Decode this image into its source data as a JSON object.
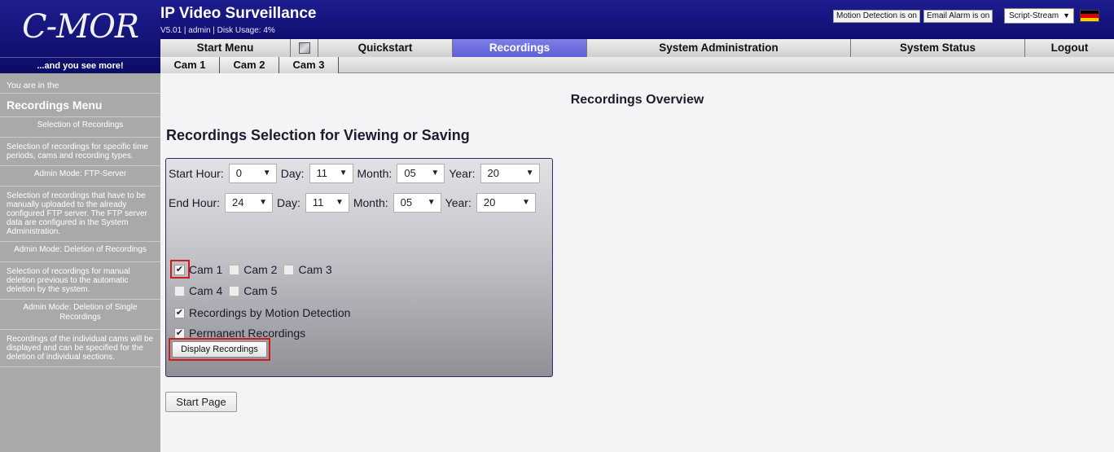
{
  "logo": {
    "text": "C-MOR",
    "tagline": "...and you see more!"
  },
  "header": {
    "title": "IP Video Surveillance",
    "version_info": "V5.01 | admin | Disk Usage: 4%",
    "motion_chip": "Motion Detection is on",
    "email_chip": "Email Alarm is on",
    "script_select": "Script-Stream",
    "flag_colors": [
      "#000000",
      "#dd0000",
      "#ffce00"
    ]
  },
  "mainnav": {
    "start": "Start Menu",
    "icon": "screen-icon",
    "quickstart": "Quickstart",
    "recordings": "Recordings",
    "sysadmin": "System Administration",
    "status": "System Status",
    "logout": "Logout",
    "active_color": "#6666dd"
  },
  "camnav": [
    "Cam 1",
    "Cam 2",
    "Cam 3"
  ],
  "sidebar": {
    "you_are_in": "You are in the",
    "menu_title": "Recordings Menu",
    "sections": [
      {
        "title": "Selection of Recordings",
        "desc": "Selection of recordings for specific time periods, cams and recording types."
      },
      {
        "title": "Admin Mode: FTP-Server",
        "desc": "Selection of recordings that have to be manually uploaded to the already configured FTP server. The FTP server data are configured in the System Administration."
      },
      {
        "title": "Admin Mode: Deletion of Recordings",
        "desc": "Selection of recordings for manual deletion previous to the automatic deletion by the system."
      },
      {
        "title": "Admin Mode: Deletion of Single Recordings",
        "desc": "Recordings of the individual cams will be displayed and can be specified for the deletion of individual sections."
      }
    ]
  },
  "content": {
    "page_title": "Recordings Overview",
    "section_title": "Recordings Selection for Viewing or Saving",
    "start": {
      "hour_label": "Start Hour:",
      "hour": "0",
      "day_label": "Day:",
      "day": "11",
      "month_label": "Month:",
      "month": "05",
      "year_label": "Year:",
      "year": "20"
    },
    "end": {
      "hour_label": "End Hour:",
      "hour": "24",
      "day_label": "Day:",
      "day": "11",
      "month_label": "Month:",
      "month": "05",
      "year_label": "Year:",
      "year": "20"
    },
    "cams": [
      {
        "label": "Cam 1",
        "checked": true
      },
      {
        "label": "Cam 2",
        "checked": false
      },
      {
        "label": "Cam 3",
        "checked": false
      },
      {
        "label": "Cam 4",
        "checked": false
      },
      {
        "label": "Cam 5",
        "checked": false
      }
    ],
    "motion_label": "Recordings by Motion Detection",
    "permanent_label": "Permanent Recordings",
    "display_button": "Display Recordings",
    "start_page_button": "Start Page",
    "highlight_color": "#d21c1c"
  }
}
